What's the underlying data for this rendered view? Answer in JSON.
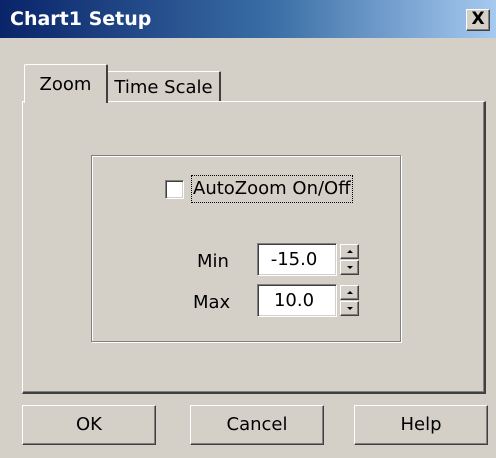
{
  "window": {
    "title": "Chart1 Setup",
    "close_label": "X"
  },
  "tabs": [
    {
      "label": "Zoom",
      "active": true
    },
    {
      "label": "Time Scale",
      "active": false
    }
  ],
  "zoom": {
    "autozoom_label": "AutoZoom On/Off",
    "autozoom_checked": false,
    "min_label": "Min",
    "min_value": "-15.0",
    "max_label": "Max",
    "max_value": "10.0"
  },
  "buttons": {
    "ok": "OK",
    "cancel": "Cancel",
    "help": "Help"
  },
  "colors": {
    "face": "#d4d0c8",
    "title_start": "#0a246a",
    "title_end": "#a6caf0"
  }
}
